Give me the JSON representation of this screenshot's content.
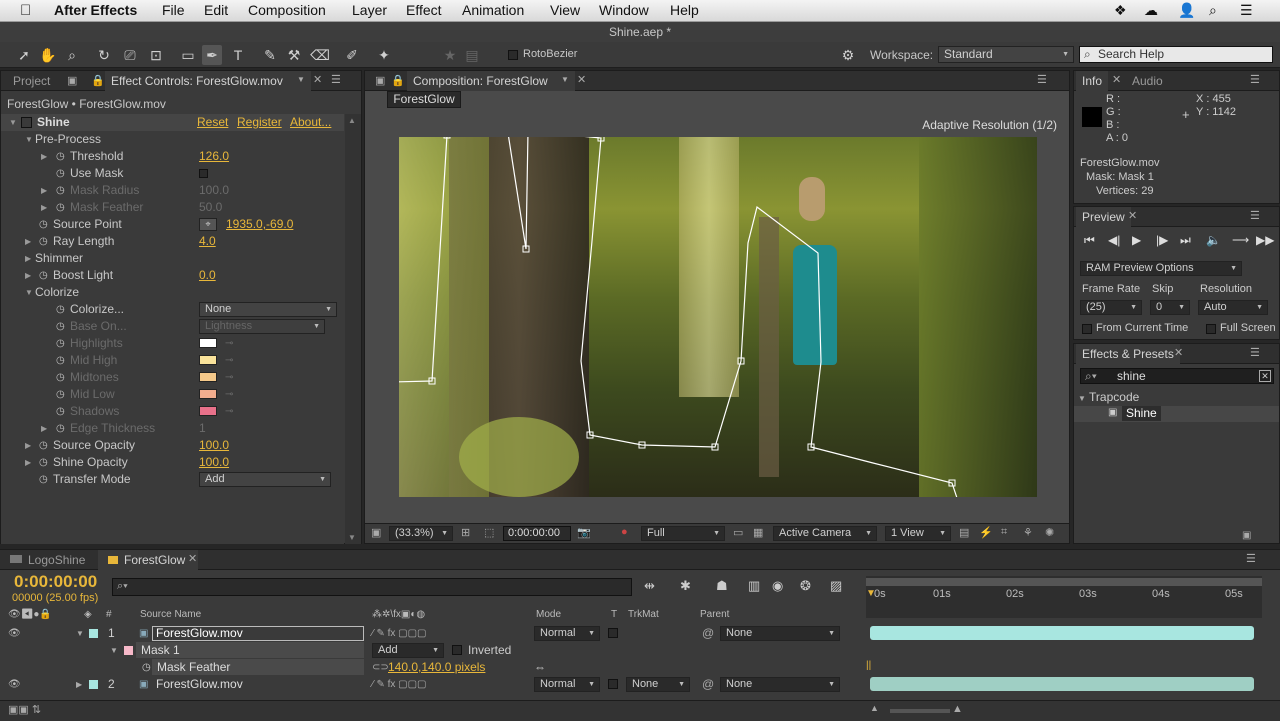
{
  "menubar": {
    "app_name": "After Effects",
    "items": [
      "File",
      "Edit",
      "Composition",
      "Layer",
      "Effect",
      "Animation",
      "View",
      "Window",
      "Help"
    ]
  },
  "window_title": "Shine.aep *",
  "toolbar": {
    "rotobezier_label": "RotoBezier",
    "workspace_label": "Workspace:",
    "workspace_value": "Standard",
    "search_placeholder": "Search Help"
  },
  "effect_panel": {
    "tab_project": "Project",
    "tab_effect": "Effect Controls: ForestGlow.mov",
    "breadcrumb": "ForestGlow • ForestGlow.mov",
    "effect_name": "Shine",
    "reset": "Reset",
    "register": "Register",
    "about": "About...",
    "rows": {
      "preprocess": "Pre-Process",
      "threshold": "Threshold",
      "threshold_val": "126.0",
      "usemask": "Use Mask",
      "maskradius": "Mask Radius",
      "maskradius_val": "100.0",
      "maskfeather": "Mask Feather",
      "maskfeather_val": "50.0",
      "sourcepoint": "Source Point",
      "sourcepoint_val": "1935.0,-69.0",
      "raylength": "Ray Length",
      "raylength_val": "4.0",
      "shimmer": "Shimmer",
      "boostlight": "Boost Light",
      "boostlight_val": "0.0",
      "colorize": "Colorize",
      "colorize_sel": "Colorize...",
      "colorize_val": "None",
      "baseon": "Base On...",
      "baseon_val": "Lightness",
      "highlights": "Highlights",
      "midhigh": "Mid High",
      "midtones": "Midtones",
      "midlow": "Mid Low",
      "shadows": "Shadows",
      "edgethickness": "Edge Thickness",
      "edgethickness_val": "1",
      "sourceopacity": "Source Opacity",
      "sourceopacity_val": "100.0",
      "shineopacity": "Shine Opacity",
      "shineopacity_val": "100.0",
      "transfermode": "Transfer Mode",
      "transfermode_val": "Add"
    },
    "colors": {
      "highlights": "#ffffff",
      "midhigh": "#f9e29a",
      "midtones": "#f5c98a",
      "midlow": "#f2ad8e",
      "shadows": "#e8718a"
    }
  },
  "comp_panel": {
    "tab": "Composition: ForestGlow",
    "comp_tab": "ForestGlow",
    "adaptive": "Adaptive Resolution (1/2)",
    "zoom": "(33.3%)",
    "timecode": "0:00:00:00",
    "resolution": "Full",
    "camera": "Active Camera",
    "views": "1 View"
  },
  "info_panel": {
    "tab_info": "Info",
    "tab_audio": "Audio",
    "r": "R :",
    "g": "G :",
    "b": "B :",
    "a": "A : 0",
    "x": "X : 455",
    "y": "Y : 1142",
    "file": "ForestGlow.mov",
    "mask": "Mask: Mask 1",
    "vertices": "Vertices: 29"
  },
  "preview_panel": {
    "tab": "Preview",
    "ram_options": "RAM Preview Options",
    "frame_rate_label": "Frame Rate",
    "skip_label": "Skip",
    "resolution_label": "Resolution",
    "frame_rate_val": "(25)",
    "skip_val": "0",
    "resolution_val": "Auto",
    "from_current": "From Current Time",
    "full_screen": "Full Screen"
  },
  "effects_presets": {
    "tab": "Effects & Presets",
    "search_value": "shine",
    "category": "Trapcode",
    "item": "Shine"
  },
  "timeline": {
    "tab_logo": "LogoShine",
    "tab_forest": "ForestGlow",
    "timecode": "0:00:00:00",
    "fps": "00000 (25.00 fps)",
    "col_hash": "#",
    "col_source": "Source Name",
    "col_mode": "Mode",
    "col_t": "T",
    "col_trkmat": "TrkMat",
    "col_parent": "Parent",
    "ruler": [
      "0s",
      "01s",
      "02s",
      "03s",
      "04s",
      "05s"
    ],
    "layers": [
      {
        "num": "1",
        "name": "ForestGlow.mov",
        "mode": "Normal",
        "parent": "None"
      },
      {
        "num": "2",
        "name": "ForestGlow.mov",
        "mode": "Normal",
        "trkmat": "None",
        "parent": "None"
      }
    ],
    "mask_name": "Mask 1",
    "mask_mode": "Add",
    "mask_inverted": "Inverted",
    "mask_feather": "Mask Feather",
    "mask_feather_val": "140.0,140.0 pixels"
  }
}
